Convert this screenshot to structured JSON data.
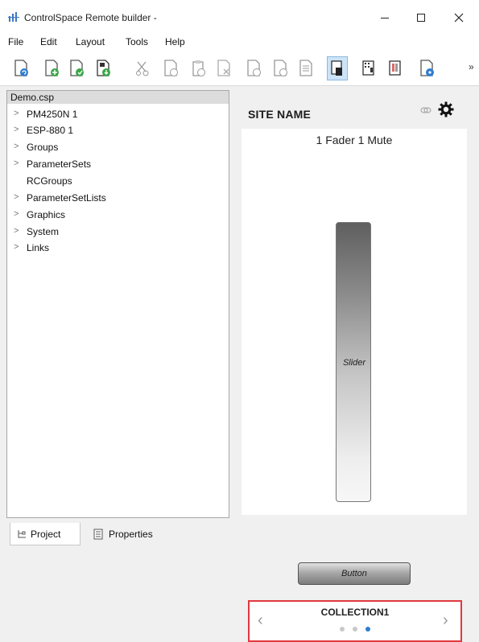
{
  "window": {
    "title": "ControlSpace Remote builder -",
    "controls": [
      "minimize-icon",
      "maximize-icon",
      "close-icon"
    ]
  },
  "menu": {
    "items": [
      "File",
      "Edit",
      "Layout",
      "Tools",
      "Help"
    ]
  },
  "toolbar": {
    "buttons": [
      {
        "icon": "document-refresh-icon"
      },
      {
        "icon": "new-document-icon"
      },
      {
        "icon": "open-document-icon"
      },
      {
        "icon": "save-document-icon"
      },
      {
        "icon": "cut-icon"
      },
      {
        "icon": "copy-icon"
      },
      {
        "icon": "paste-icon"
      },
      {
        "icon": "delete-icon"
      },
      {
        "icon": "undo-icon"
      },
      {
        "icon": "redo-icon"
      },
      {
        "icon": "list-icon"
      },
      {
        "icon": "select-tool-icon",
        "active": true
      },
      {
        "icon": "grid-tool-icon"
      },
      {
        "icon": "preview-icon"
      }
    ],
    "overflow_label": "»"
  },
  "tree": {
    "root": "Demo.csp",
    "items": [
      {
        "label": "PM4250N 1",
        "expandable": true
      },
      {
        "label": "ESP-880 1",
        "expandable": true
      },
      {
        "label": "Groups",
        "expandable": true
      },
      {
        "label": "ParameterSets",
        "expandable": true
      },
      {
        "label": "RCGroups",
        "expandable": false
      },
      {
        "label": "ParameterSetLists",
        "expandable": true
      },
      {
        "label": "Graphics",
        "expandable": true
      },
      {
        "label": "System",
        "expandable": true
      },
      {
        "label": "Links",
        "expandable": true
      }
    ]
  },
  "tabs": {
    "project": "Project",
    "properties": "Properties"
  },
  "preview": {
    "site_name": "SITE NAME",
    "group_title": "1 Fader 1 Mute",
    "slider_label": "Slider",
    "button_label": "Button",
    "collection": {
      "label": "COLLECTION1",
      "prev": "‹",
      "next": "›",
      "page_count": 3,
      "active_page": 3
    }
  },
  "colors": {
    "accent_blue": "#2f7dd1",
    "highlight_red": "#e0393e",
    "tree_selected": "#dcdcdc",
    "toolbar_active": "#cce4f7"
  }
}
